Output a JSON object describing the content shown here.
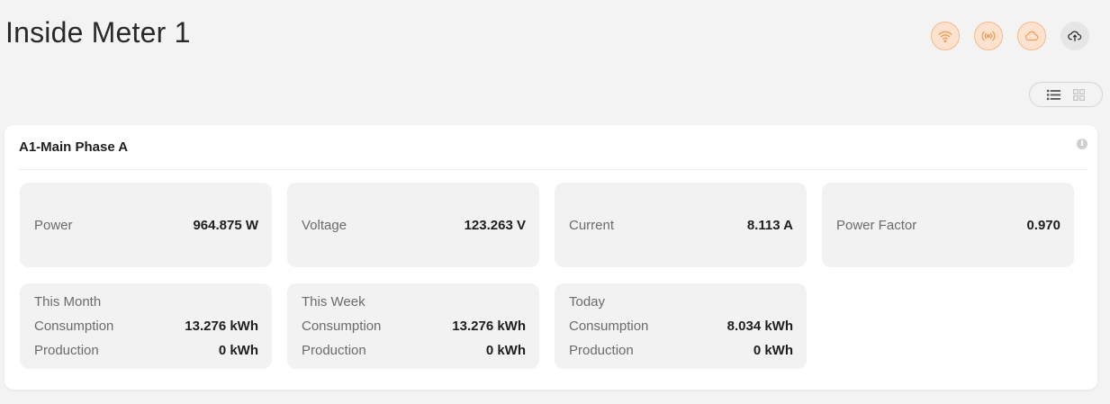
{
  "page": {
    "title": "Inside Meter 1"
  },
  "status_icons": [
    {
      "name": "wifi-icon",
      "color": "#f0a060"
    },
    {
      "name": "broadcast-icon",
      "color": "#f0a060"
    },
    {
      "name": "cloud-icon",
      "color": "#f0a060"
    },
    {
      "name": "cloud-sync-icon",
      "color": "#333333"
    }
  ],
  "view_toggle": {
    "options": [
      "list-view",
      "grid-view"
    ],
    "selected": "list-view"
  },
  "card": {
    "title": "A1-Main Phase A",
    "metrics": [
      {
        "label": "Power",
        "value": "964.875 W"
      },
      {
        "label": "Voltage",
        "value": "123.263 V"
      },
      {
        "label": "Current",
        "value": "8.113 A"
      },
      {
        "label": "Power Factor",
        "value": "0.970"
      }
    ],
    "energy": [
      {
        "period": "This Month",
        "consumption_label": "Consumption",
        "consumption": "13.276 kWh",
        "production_label": "Production",
        "production": "0 kWh"
      },
      {
        "period": "This Week",
        "consumption_label": "Consumption",
        "consumption": "13.276 kWh",
        "production_label": "Production",
        "production": "0 kWh"
      },
      {
        "period": "Today",
        "consumption_label": "Consumption",
        "consumption": "8.034 kWh",
        "production_label": "Production",
        "production": "0 kWh"
      }
    ]
  }
}
